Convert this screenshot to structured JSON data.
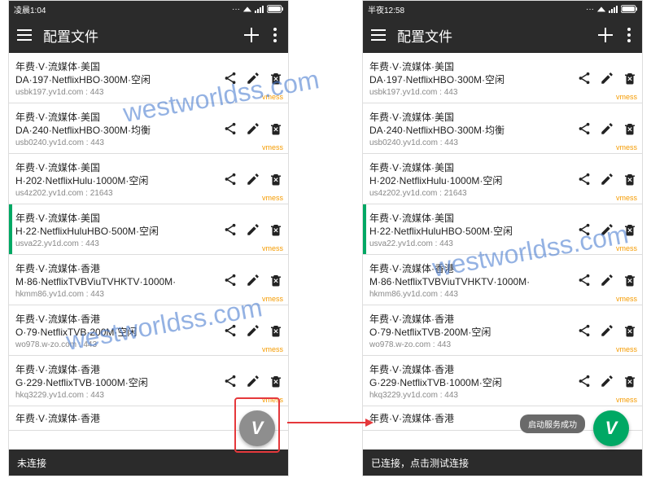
{
  "watermark": "westworldss.com",
  "left": {
    "status_time": "凌晨1:04",
    "app_title": "配置文件",
    "footer": "未连接",
    "fab_variant": "gray",
    "show_highlight": true,
    "toast": null,
    "items": [
      {
        "title": "年费·V·流媒体·美国\nDA·197·NetflixHBO·300M·空闲",
        "sub": "usbk197.yv1d.com : 443",
        "tag": "vmess",
        "active": false
      },
      {
        "title": "年费·V·流媒体·美国\nDA·240·NetflixHBO·300M·均衡",
        "sub": "usb0240.yv1d.com : 443",
        "tag": "vmess",
        "active": false
      },
      {
        "title": "年费·V·流媒体·美国\nH·202·NetflixHulu·1000M·空闲",
        "sub": "us4z202.yv1d.com : 21643",
        "tag": "vmess",
        "active": false
      },
      {
        "title": "年费·V·流媒体·美国\nH·22·NetflixHuluHBO·500M·空闲",
        "sub": "usva22.yv1d.com : 443",
        "tag": "vmess",
        "active": true
      },
      {
        "title": "年费·V·流媒体·香港\nM·86·NetflixTVBViuTVHKTV·1000M·",
        "sub": "hkmm86.yv1d.com : 443",
        "tag": "vmess",
        "active": false
      },
      {
        "title": "年费·V·流媒体·香港\nO·79·NetflixTVB·200M·空闲",
        "sub": "wo978.w-zo.com : 443",
        "tag": "vmess",
        "active": false
      },
      {
        "title": "年费·V·流媒体·香港\nG·229·NetflixTVB·1000M·空闲",
        "sub": "hkq3229.yv1d.com : 443",
        "tag": "vmess",
        "active": false
      },
      {
        "title": "年费·V·流媒体·香港",
        "sub": "",
        "tag": "",
        "active": false,
        "short": true
      }
    ]
  },
  "right": {
    "status_time": "半夜12:58",
    "app_title": "配置文件",
    "footer": "已连接，点击测试连接",
    "fab_variant": "green",
    "show_highlight": false,
    "toast": "启动服务成功",
    "items": [
      {
        "title": "年费·V·流媒体·美国\nDA·197·NetflixHBO·300M·空闲",
        "sub": "usbk197.yv1d.com : 443",
        "tag": "vmess",
        "active": false
      },
      {
        "title": "年费·V·流媒体·美国\nDA·240·NetflixHBO·300M·均衡",
        "sub": "usb0240.yv1d.com : 443",
        "tag": "vmess",
        "active": false
      },
      {
        "title": "年费·V·流媒体·美国\nH·202·NetflixHulu·1000M·空闲",
        "sub": "us4z202.yv1d.com : 21643",
        "tag": "vmess",
        "active": false
      },
      {
        "title": "年费·V·流媒体·美国\nH·22·NetflixHuluHBO·500M·空闲",
        "sub": "usva22.yv1d.com : 443",
        "tag": "vmess",
        "active": true
      },
      {
        "title": "年费·V·流媒体·香港\nM·86·NetflixTVBViuTVHKTV·1000M·",
        "sub": "hkmm86.yv1d.com : 443",
        "tag": "vmess",
        "active": false
      },
      {
        "title": "年费·V·流媒体·香港\nO·79·NetflixTVB·200M·空闲",
        "sub": "wo978.w-zo.com : 443",
        "tag": "vmess",
        "active": false
      },
      {
        "title": "年费·V·流媒体·香港\nG·229·NetflixTVB·1000M·空闲",
        "sub": "hkq3229.yv1d.com : 443",
        "tag": "vmess",
        "active": false
      },
      {
        "title": "年费·V·流媒体·香港",
        "sub": "",
        "tag": "",
        "active": false,
        "short": true
      }
    ]
  }
}
